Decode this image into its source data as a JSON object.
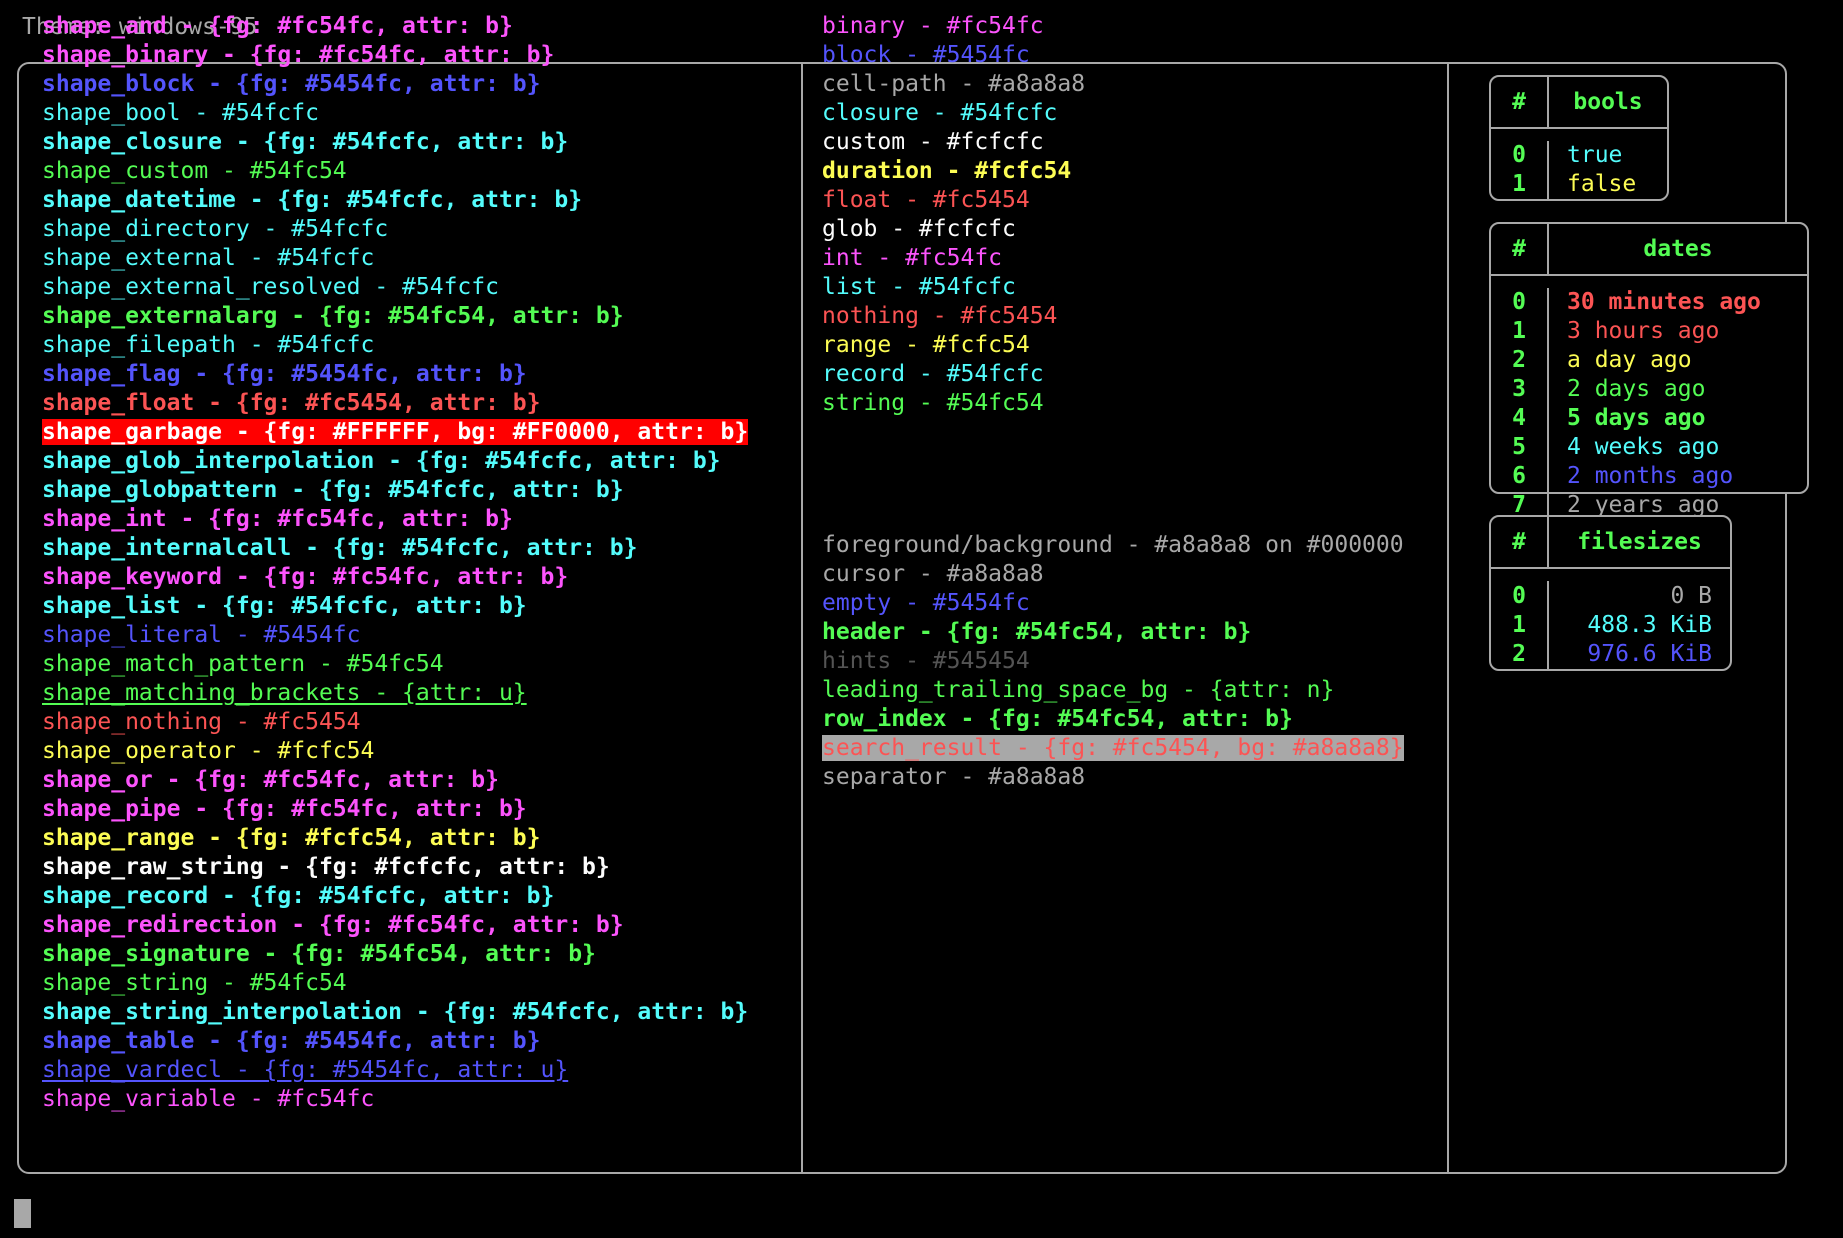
{
  "header": {
    "theme_line": "Theme: windows-95"
  },
  "colors": {
    "fg_default": "#a8a8a8",
    "magenta": "#fc54fc",
    "blue": "#5454fc",
    "cyan": "#54fcfc",
    "green": "#54fc54",
    "red": "#fc5454",
    "yellow": "#fcfc54",
    "white": "#fcfcfc",
    "dark_gray": "#545454",
    "garbage_fg": "#FFFFFF",
    "garbage_bg": "#FF0000",
    "search_result_fg": "#fc5454",
    "search_result_bg": "#a8a8a8"
  },
  "left_column": [
    {
      "text": "shape_and - {fg: #fc54fc, attr: b}",
      "color": "#fc54fc",
      "bold": true,
      "underline": false
    },
    {
      "text": "shape_binary - {fg: #fc54fc, attr: b}",
      "color": "#fc54fc",
      "bold": true,
      "underline": false
    },
    {
      "text": "shape_block - {fg: #5454fc, attr: b}",
      "color": "#5454fc",
      "bold": true,
      "underline": false
    },
    {
      "text": "shape_bool - #54fcfc",
      "color": "#54fcfc",
      "bold": false,
      "underline": false
    },
    {
      "text": "shape_closure - {fg: #54fcfc, attr: b}",
      "color": "#54fcfc",
      "bold": true,
      "underline": false
    },
    {
      "text": "shape_custom - #54fc54",
      "color": "#54fc54",
      "bold": false,
      "underline": false
    },
    {
      "text": "shape_datetime - {fg: #54fcfc, attr: b}",
      "color": "#54fcfc",
      "bold": true,
      "underline": false
    },
    {
      "text": "shape_directory - #54fcfc",
      "color": "#54fcfc",
      "bold": false,
      "underline": false
    },
    {
      "text": "shape_external - #54fcfc",
      "color": "#54fcfc",
      "bold": false,
      "underline": false
    },
    {
      "text": "shape_external_resolved - #54fcfc",
      "color": "#54fcfc",
      "bold": false,
      "underline": false
    },
    {
      "text": "shape_externalarg - {fg: #54fc54, attr: b}",
      "color": "#54fc54",
      "bold": true,
      "underline": false
    },
    {
      "text": "shape_filepath - #54fcfc",
      "color": "#54fcfc",
      "bold": false,
      "underline": false
    },
    {
      "text": "shape_flag - {fg: #5454fc, attr: b}",
      "color": "#5454fc",
      "bold": true,
      "underline": false
    },
    {
      "text": "shape_float - {fg: #fc5454, attr: b}",
      "color": "#fc5454",
      "bold": true,
      "underline": false
    },
    {
      "text": "shape_garbage - {fg: #FFFFFF, bg: #FF0000, attr: b}",
      "color": "#FFFFFF",
      "bg": "#FF0000",
      "bold": true,
      "underline": false
    },
    {
      "text": "shape_glob_interpolation - {fg: #54fcfc, attr: b}",
      "color": "#54fcfc",
      "bold": true,
      "underline": false
    },
    {
      "text": "shape_globpattern - {fg: #54fcfc, attr: b}",
      "color": "#54fcfc",
      "bold": true,
      "underline": false
    },
    {
      "text": "shape_int - {fg: #fc54fc, attr: b}",
      "color": "#fc54fc",
      "bold": true,
      "underline": false
    },
    {
      "text": "shape_internalcall - {fg: #54fcfc, attr: b}",
      "color": "#54fcfc",
      "bold": true,
      "underline": false
    },
    {
      "text": "shape_keyword - {fg: #fc54fc, attr: b}",
      "color": "#fc54fc",
      "bold": true,
      "underline": false
    },
    {
      "text": "shape_list - {fg: #54fcfc, attr: b}",
      "color": "#54fcfc",
      "bold": true,
      "underline": false
    },
    {
      "text": "shape_literal - #5454fc",
      "color": "#5454fc",
      "bold": false,
      "underline": false
    },
    {
      "text": "shape_match_pattern - #54fc54",
      "color": "#54fc54",
      "bold": false,
      "underline": false
    },
    {
      "text": "shape_matching_brackets - {attr: u}",
      "color": "#54fc54",
      "bold": false,
      "underline": true
    },
    {
      "text": "shape_nothing - #fc5454",
      "color": "#fc5454",
      "bold": false,
      "underline": false
    },
    {
      "text": "shape_operator - #fcfc54",
      "color": "#fcfc54",
      "bold": false,
      "underline": false
    },
    {
      "text": "shape_or - {fg: #fc54fc, attr: b}",
      "color": "#fc54fc",
      "bold": true,
      "underline": false
    },
    {
      "text": "shape_pipe - {fg: #fc54fc, attr: b}",
      "color": "#fc54fc",
      "bold": true,
      "underline": false
    },
    {
      "text": "shape_range - {fg: #fcfc54, attr: b}",
      "color": "#fcfc54",
      "bold": true,
      "underline": false
    },
    {
      "text": "shape_raw_string - {fg: #fcfcfc, attr: b}",
      "color": "#fcfcfc",
      "bold": true,
      "underline": false
    },
    {
      "text": "shape_record - {fg: #54fcfc, attr: b}",
      "color": "#54fcfc",
      "bold": true,
      "underline": false
    },
    {
      "text": "shape_redirection - {fg: #fc54fc, attr: b}",
      "color": "#fc54fc",
      "bold": true,
      "underline": false
    },
    {
      "text": "shape_signature - {fg: #54fc54, attr: b}",
      "color": "#54fc54",
      "bold": true,
      "underline": false
    },
    {
      "text": "shape_string - #54fc54",
      "color": "#54fc54",
      "bold": false,
      "underline": false
    },
    {
      "text": "shape_string_interpolation - {fg: #54fcfc, attr: b}",
      "color": "#54fcfc",
      "bold": true,
      "underline": false
    },
    {
      "text": "shape_table - {fg: #5454fc, attr: b}",
      "color": "#5454fc",
      "bold": true,
      "underline": false
    },
    {
      "text": "shape_vardecl - {fg: #5454fc, attr: u}",
      "color": "#5454fc",
      "bold": false,
      "underline": true
    },
    {
      "text": "shape_variable - #fc54fc",
      "color": "#fc54fc",
      "bold": false,
      "underline": false
    }
  ],
  "middle_column_top": [
    {
      "text": "binary - #fc54fc",
      "color": "#fc54fc",
      "bold": false
    },
    {
      "text": "block - #5454fc",
      "color": "#5454fc",
      "bold": false
    },
    {
      "text": "cell-path - #a8a8a8",
      "color": "#a8a8a8",
      "bold": false
    },
    {
      "text": "closure - #54fcfc",
      "color": "#54fcfc",
      "bold": false
    },
    {
      "text": "custom - #fcfcfc",
      "color": "#fcfcfc",
      "bold": false
    },
    {
      "text": "duration - #fcfc54",
      "color": "#fcfc54",
      "bold": true
    },
    {
      "text": "float - #fc5454",
      "color": "#fc5454",
      "bold": false
    },
    {
      "text": "glob - #fcfcfc",
      "color": "#fcfcfc",
      "bold": false
    },
    {
      "text": "int - #fc54fc",
      "color": "#fc54fc",
      "bold": false
    },
    {
      "text": "list - #54fcfc",
      "color": "#54fcfc",
      "bold": false
    },
    {
      "text": "nothing - #fc5454",
      "color": "#fc5454",
      "bold": false
    },
    {
      "text": "range - #fcfc54",
      "color": "#fcfc54",
      "bold": false
    },
    {
      "text": "record - #54fcfc",
      "color": "#54fcfc",
      "bold": false
    },
    {
      "text": "string - #54fc54",
      "color": "#54fc54",
      "bold": false
    }
  ],
  "middle_column_bottom": [
    {
      "text": "foreground/background - #a8a8a8 on #000000",
      "color": "#a8a8a8",
      "bold": false
    },
    {
      "text": "cursor - #a8a8a8",
      "color": "#a8a8a8",
      "bold": false
    },
    {
      "text": "empty - #5454fc",
      "color": "#5454fc",
      "bold": false
    },
    {
      "text": "header - {fg: #54fc54, attr: b}",
      "color": "#54fc54",
      "bold": true
    },
    {
      "text": "hints - #545454",
      "color": "#545454",
      "bold": false
    },
    {
      "text": "leading_trailing_space_bg - {attr: n}",
      "color": "#54fc54",
      "bold": false
    },
    {
      "text": "row_index - {fg: #54fc54, attr: b}",
      "color": "#54fc54",
      "bold": true
    },
    {
      "text": "search_result - {fg: #fc5454, bg: #a8a8a8}",
      "color": "#fc5454",
      "bg": "#a8a8a8",
      "bold": false
    },
    {
      "text": "separator - #a8a8a8",
      "color": "#a8a8a8",
      "bold": false
    }
  ],
  "tables": {
    "bools": {
      "index_header": "#",
      "value_header": "bools",
      "rows": [
        {
          "index": "0",
          "value": "true",
          "color": "#54fcfc",
          "bold": false
        },
        {
          "index": "1",
          "value": "false",
          "color": "#fcfc54",
          "bold": false
        }
      ]
    },
    "dates": {
      "index_header": "#",
      "value_header": "dates",
      "rows": [
        {
          "index": "0",
          "value": "30 minutes ago",
          "color": "#fc5454",
          "bold": true
        },
        {
          "index": "1",
          "value": "3 hours ago",
          "color": "#fc5454",
          "bold": false
        },
        {
          "index": "2",
          "value": "a day ago",
          "color": "#fcfc54",
          "bold": false
        },
        {
          "index": "3",
          "value": "2 days ago",
          "color": "#54fc54",
          "bold": false
        },
        {
          "index": "4",
          "value": "5 days ago",
          "color": "#54fc54",
          "bold": true
        },
        {
          "index": "5",
          "value": "4 weeks ago",
          "color": "#54fcfc",
          "bold": false
        },
        {
          "index": "6",
          "value": "2 months ago",
          "color": "#5454fc",
          "bold": false
        },
        {
          "index": "7",
          "value": "2 years ago",
          "color": "#a8a8a8",
          "bold": false
        }
      ]
    },
    "filesizes": {
      "index_header": "#",
      "value_header": "filesizes",
      "rows": [
        {
          "index": "0",
          "value": "0 B",
          "color": "#a8a8a8",
          "bold": false
        },
        {
          "index": "1",
          "value": "488.3 KiB",
          "color": "#54fcfc",
          "bold": false
        },
        {
          "index": "2",
          "value": "976.6 KiB",
          "color": "#5454fc",
          "bold": false
        }
      ]
    }
  },
  "prompt": {
    "cursor": "block-cursor"
  }
}
